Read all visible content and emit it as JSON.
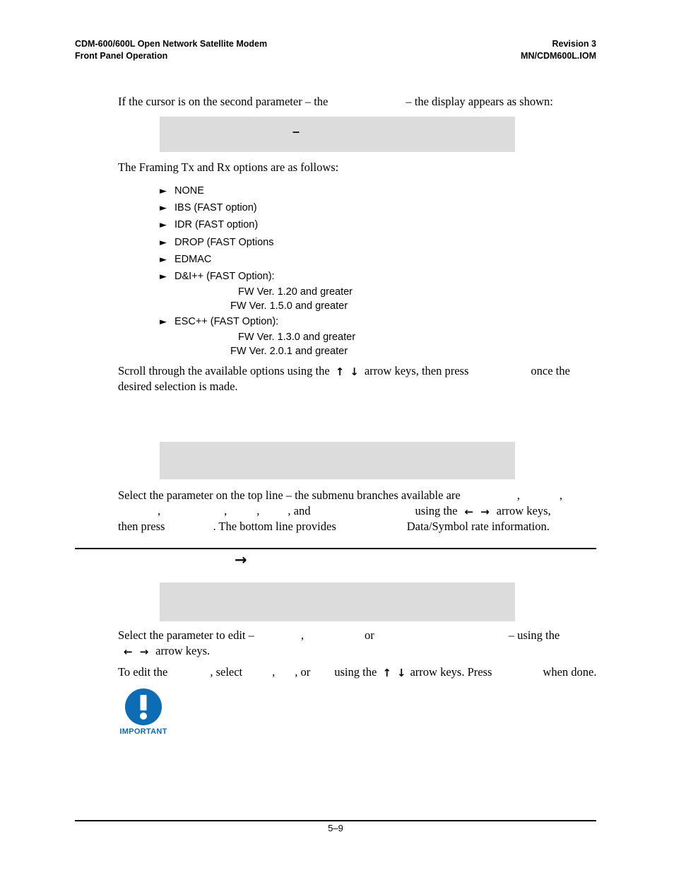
{
  "header": {
    "left_line1": "CDM-600/600L Open Network Satellite Modem",
    "left_line2": "Front Panel Operation",
    "right_line1": "Revision 3",
    "right_line2": "MN/CDM600L.IOM"
  },
  "intro": {
    "part1": "If the cursor is on the second parameter – the",
    "part2": "– the display appears as shown:"
  },
  "display_1": {
    "content": "–"
  },
  "framing_intro": "The Framing Tx and Rx options are as follows:",
  "bullet_marker": "►",
  "framing_options": [
    {
      "label": "NONE",
      "subs": []
    },
    {
      "label": "IBS (FAST option)",
      "subs": []
    },
    {
      "label": "IDR (FAST option)",
      "subs": []
    },
    {
      "label": "DROP (FAST Options",
      "subs": []
    },
    {
      "label": "EDMAC",
      "subs": []
    },
    {
      "label": "D&I++ (FAST Option):",
      "subs": [
        "FW Ver. 1.20 and greater",
        "FW Ver. 1.5.0 and greater"
      ]
    },
    {
      "label": "ESC++ (FAST Option):",
      "subs": [
        "FW Ver. 1.3.0 and greater",
        "FW Ver. 2.0.1 and greater"
      ]
    }
  ],
  "scroll_para": {
    "part1": "Scroll  through  the  available  options  using  the",
    "arrow_up": "↑",
    "arrow_down": "↓",
    "part2": "arrow  keys,  then  press",
    "part3": "once  the",
    "part4": "desired selection is made."
  },
  "display_2": {
    "content": ""
  },
  "select_top_para": {
    "part1": "Select  the  parameter  on  the  top  line  –  the  submenu  branches  available  are",
    "comma1": ",",
    "comma2": ",",
    "comma3": ",",
    "comma4": ",",
    "comma5": ",",
    "comma6": ",",
    "and_word": "and",
    "part2": "using  the",
    "arrow_left": "←",
    "arrow_right": "→",
    "part3": "arrow  keys,",
    "part4": "then press",
    "part5": ". The bottom line provides",
    "part6": "Data/Symbol rate information."
  },
  "section_arrow": "→",
  "display_3": {
    "content": ""
  },
  "select_edit_para": {
    "part1": "Select  the  parameter  to  edit  –",
    "comma1": ",",
    "or_word": "or",
    "part2": "–  using  the",
    "arrow_left": "←",
    "arrow_right": "→",
    "part3": "arrow keys."
  },
  "to_edit_para": {
    "part1": "To edit the",
    "part2": ", select",
    "comma1": ",",
    "comma2": ",",
    "or_word": "or",
    "part3": "using the",
    "arrow_up": "↑",
    "arrow_down": "↓",
    "part4": "arrow keys. Press",
    "part5": "when done."
  },
  "important": {
    "label": "IMPORTANT",
    "icon": "exclamation-icon",
    "color": "#0c6cb4"
  },
  "footer": {
    "page_number": "5–9"
  },
  "colors": {
    "display_background": "#dcdcdc",
    "rule": "#000000",
    "text": "#000000",
    "important_blue": "#0c6cb4"
  }
}
